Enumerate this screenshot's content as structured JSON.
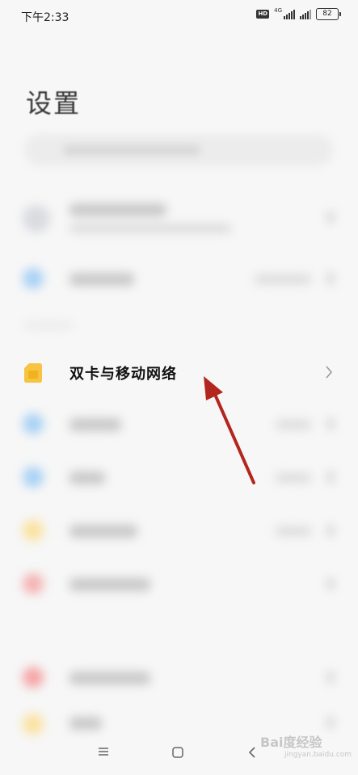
{
  "status_bar": {
    "time": "下午2:33",
    "hd_badge": "HD",
    "network_type": "4G",
    "battery_level": "82"
  },
  "page": {
    "title": "设置"
  },
  "highlighted_item": {
    "label": "双卡与移动网络",
    "icon": "sim-card-icon",
    "icon_color": "#f6c342"
  },
  "nav_bar": {
    "menu_icon": "menu-icon",
    "home_icon": "home-icon",
    "back_icon": "back-icon"
  },
  "watermark": {
    "logo_text": "Bai度经验",
    "url": "jingyan.baidu.com"
  },
  "colors": {
    "annotation_arrow": "#b3261e",
    "background": "#f7f7f7"
  }
}
